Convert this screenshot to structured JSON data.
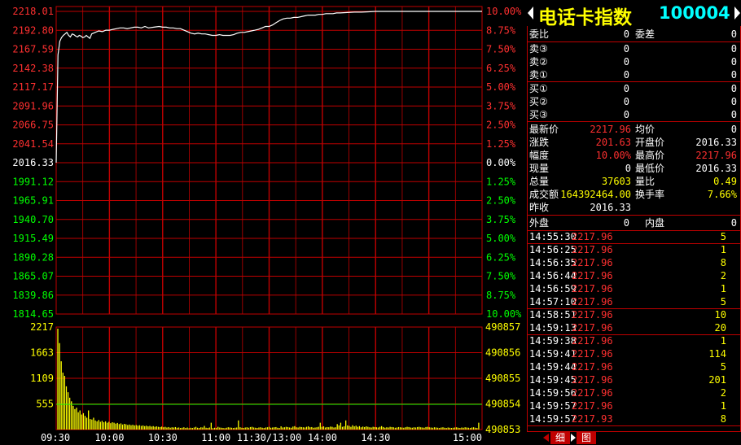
{
  "header": {
    "title": "电话卡指数",
    "code": "100004"
  },
  "order_book": {
    "wei_bi_label": "委比",
    "wei_bi_value": "0",
    "wei_cha_label": "委差",
    "wei_cha_value": "0",
    "sell": [
      {
        "label": "卖③",
        "price": "0",
        "vol": "0"
      },
      {
        "label": "卖②",
        "price": "0",
        "vol": "0"
      },
      {
        "label": "卖①",
        "price": "0",
        "vol": "0"
      }
    ],
    "buy": [
      {
        "label": "买①",
        "price": "0",
        "vol": "0"
      },
      {
        "label": "买②",
        "price": "0",
        "vol": "0"
      },
      {
        "label": "买③",
        "price": "0",
        "vol": "0"
      }
    ]
  },
  "quote": {
    "latest_label": "最新价",
    "latest": "2217.96",
    "avg_label": "均价",
    "avg": "0",
    "change_label": "涨跌",
    "change": "201.63",
    "open_label": "开盘价",
    "open": "2016.33",
    "amp_label": "幅度",
    "amp": "10.00%",
    "high_label": "最高价",
    "high": "2217.96",
    "cur_vol_label": "现量",
    "cur_vol": "0",
    "low_label": "最低价",
    "low": "2016.33",
    "total_vol_label": "总量",
    "total_vol": "37603",
    "vol_ratio_label": "量比",
    "vol_ratio": "0.49",
    "turnover_label": "成交额",
    "turnover": "164392464.00",
    "turn_rate_label": "换手率",
    "turn_rate": "7.66%",
    "prev_close_label": "昨收",
    "prev_close": "2016.33"
  },
  "outer_inner": {
    "outer_label": "外盘",
    "outer": "0",
    "inner_label": "内盘",
    "inner": "0"
  },
  "ticks": [
    {
      "time": "14:55:30",
      "price": "2217.96",
      "vol": "5"
    },
    {
      "time": "14:56:25",
      "price": "2217.96",
      "vol": "1"
    },
    {
      "time": "14:56:35",
      "price": "2217.96",
      "vol": "8"
    },
    {
      "time": "14:56:44",
      "price": "2217.96",
      "vol": "2"
    },
    {
      "time": "14:56:59",
      "price": "2217.96",
      "vol": "1"
    },
    {
      "time": "14:57:10",
      "price": "2217.96",
      "vol": "5"
    },
    {
      "time": "14:58:51",
      "price": "2217.96",
      "vol": "10"
    },
    {
      "time": "14:59:13",
      "price": "2217.96",
      "vol": "20"
    },
    {
      "time": "14:59:38",
      "price": "2217.96",
      "vol": "1"
    },
    {
      "time": "14:59:41",
      "price": "2217.96",
      "vol": "114"
    },
    {
      "time": "14:59:44",
      "price": "2217.96",
      "vol": "5"
    },
    {
      "time": "14:59:45",
      "price": "2217.96",
      "vol": "201"
    },
    {
      "time": "14:59:56",
      "price": "2217.96",
      "vol": "2"
    },
    {
      "time": "14:59:57",
      "price": "2217.96",
      "vol": "1"
    },
    {
      "time": "14:59:57",
      "price": "2217.93",
      "vol": "8"
    }
  ],
  "tabs": [
    "细",
    "图"
  ],
  "colors": {
    "grid": "#c00000",
    "up": "#ff3030",
    "down": "#00ff00",
    "neutral": "#ffffff",
    "volume": "#ffff00",
    "price_line": "#ffffff",
    "avg_line": "#00ff00"
  },
  "chart_data": {
    "type": "line",
    "price_axis_left": [
      "2218.01",
      "2192.80",
      "2167.59",
      "2142.38",
      "2117.17",
      "2091.96",
      "2066.75",
      "2041.54",
      "2016.33",
      "1991.12",
      "1965.91",
      "1940.70",
      "1915.49",
      "1890.28",
      "1865.07",
      "1839.86",
      "1814.65"
    ],
    "pct_axis_right": [
      "10.00%",
      "8.75%",
      "7.50%",
      "6.25%",
      "5.00%",
      "3.75%",
      "2.50%",
      "1.25%",
      "0.00%",
      "1.25%",
      "2.50%",
      "3.75%",
      "5.00%",
      "6.25%",
      "7.50%",
      "8.75%",
      "10.00%"
    ],
    "prev_close_index": 8,
    "ylim": [
      1814.65,
      2218.01
    ],
    "x_ticks": [
      "09:30",
      "10:00",
      "10:30",
      "11:00",
      "11:30/13:00",
      "14:00",
      "14:30",
      "15:00"
    ],
    "x_minutes": 240,
    "price_series": [
      [
        0,
        2016.33
      ],
      [
        1,
        2160
      ],
      [
        2,
        2178
      ],
      [
        3,
        2183
      ],
      [
        4,
        2186
      ],
      [
        5,
        2188
      ],
      [
        6,
        2190
      ],
      [
        7,
        2186
      ],
      [
        8,
        2184
      ],
      [
        9,
        2188
      ],
      [
        10,
        2187
      ],
      [
        11,
        2185
      ],
      [
        12,
        2184
      ],
      [
        13,
        2186
      ],
      [
        14,
        2185
      ],
      [
        15,
        2183
      ],
      [
        16,
        2184
      ],
      [
        17,
        2186
      ],
      [
        18,
        2184
      ],
      [
        19,
        2182
      ],
      [
        20,
        2188
      ],
      [
        22,
        2190
      ],
      [
        24,
        2192
      ],
      [
        26,
        2191
      ],
      [
        28,
        2193
      ],
      [
        30,
        2193
      ],
      [
        32,
        2194
      ],
      [
        34,
        2195
      ],
      [
        36,
        2196
      ],
      [
        38,
        2196
      ],
      [
        40,
        2195
      ],
      [
        42,
        2196
      ],
      [
        44,
        2197
      ],
      [
        46,
        2197
      ],
      [
        48,
        2196
      ],
      [
        50,
        2198
      ],
      [
        52,
        2196
      ],
      [
        55,
        2197
      ],
      [
        58,
        2198
      ],
      [
        60,
        2197
      ],
      [
        62,
        2197
      ],
      [
        64,
        2196
      ],
      [
        66,
        2196
      ],
      [
        68,
        2195
      ],
      [
        70,
        2195
      ],
      [
        72,
        2193
      ],
      [
        74,
        2191
      ],
      [
        76,
        2189
      ],
      [
        78,
        2188
      ],
      [
        80,
        2189
      ],
      [
        82,
        2188
      ],
      [
        84,
        2188
      ],
      [
        86,
        2187
      ],
      [
        88,
        2186
      ],
      [
        90,
        2186
      ],
      [
        92,
        2187
      ],
      [
        94,
        2186
      ],
      [
        96,
        2186
      ],
      [
        98,
        2186
      ],
      [
        100,
        2187
      ],
      [
        102,
        2189
      ],
      [
        104,
        2190
      ],
      [
        106,
        2190
      ],
      [
        108,
        2191
      ],
      [
        110,
        2192
      ],
      [
        112,
        2193
      ],
      [
        114,
        2194
      ],
      [
        116,
        2196
      ],
      [
        118,
        2198
      ],
      [
        120,
        2198
      ],
      [
        122,
        2200
      ],
      [
        124,
        2203
      ],
      [
        126,
        2206
      ],
      [
        128,
        2208
      ],
      [
        130,
        2209
      ],
      [
        132,
        2209
      ],
      [
        134,
        2210
      ],
      [
        136,
        2210
      ],
      [
        138,
        2211
      ],
      [
        140,
        2212
      ],
      [
        142,
        2213
      ],
      [
        144,
        2213
      ],
      [
        146,
        2213
      ],
      [
        148,
        2214
      ],
      [
        150,
        2214
      ],
      [
        152,
        2215
      ],
      [
        154,
        2215
      ],
      [
        156,
        2215
      ],
      [
        158,
        2216
      ],
      [
        160,
        2216
      ],
      [
        164,
        2216.5
      ],
      [
        168,
        2217
      ],
      [
        172,
        2217
      ],
      [
        176,
        2217.5
      ],
      [
        180,
        2217.96
      ],
      [
        200,
        2217.96
      ],
      [
        220,
        2217.96
      ],
      [
        240,
        2217.96
      ]
    ],
    "volume_axis_left": [
      "2217",
      "1663",
      "1109",
      "555"
    ],
    "volume_axis_right": [
      "490857",
      "490856",
      "490855",
      "490854",
      "490853"
    ],
    "volume_ylim": [
      0,
      2217
    ],
    "volume_ref": 555,
    "volume_series": [
      2217,
      1900,
      1500,
      1250,
      1180,
      950,
      820,
      700,
      620,
      520,
      450,
      480,
      380,
      420,
      330,
      360,
      300,
      260,
      420,
      230,
      220,
      260,
      200,
      180,
      210,
      170,
      190,
      160,
      180,
      150,
      170,
      140,
      160,
      150,
      130,
      145,
      120,
      135,
      110,
      125,
      115,
      100,
      110,
      95,
      105,
      90,
      100,
      85,
      95,
      80,
      90,
      75,
      85,
      70,
      80,
      65,
      75,
      60,
      70,
      60,
      55,
      65,
      50,
      60,
      45,
      55,
      40,
      50,
      45,
      55,
      40,
      45,
      35,
      40,
      50,
      35,
      45,
      30,
      40,
      35,
      45,
      60,
      40,
      35,
      50,
      45,
      80,
      40,
      35,
      45,
      150,
      30,
      40,
      35,
      60,
      45,
      40,
      35,
      30,
      40,
      50,
      45,
      40,
      35,
      40,
      45,
      200,
      50,
      40,
      35,
      45,
      50,
      40,
      55,
      60,
      45,
      40,
      35,
      45,
      50,
      40,
      35,
      45,
      50,
      60,
      40,
      45,
      50,
      55,
      40,
      35,
      70,
      45,
      50,
      60,
      55,
      45,
      40,
      65,
      75,
      50,
      45,
      60,
      55,
      50,
      45,
      60,
      70,
      50,
      55,
      40,
      45,
      50,
      60,
      150,
      60,
      70,
      45,
      55,
      50,
      65,
      60,
      45,
      50,
      120,
      90,
      150,
      60,
      70,
      200,
      90,
      80,
      60,
      95,
      70,
      85,
      60,
      75,
      50,
      65,
      55,
      70,
      60,
      50,
      45,
      60,
      55,
      50,
      45,
      60,
      75,
      55,
      40,
      50,
      45,
      60,
      55,
      50,
      40,
      45,
      55,
      50,
      45,
      40,
      50,
      60,
      55,
      45,
      40,
      50,
      45,
      55,
      60,
      50,
      45,
      40,
      55,
      60,
      50,
      45,
      40,
      50,
      45,
      40,
      35,
      45,
      50,
      40,
      35,
      45,
      40,
      35,
      40,
      45,
      50,
      40,
      35,
      45,
      40,
      50,
      45,
      40,
      35,
      45,
      50,
      40,
      35,
      150
    ]
  }
}
